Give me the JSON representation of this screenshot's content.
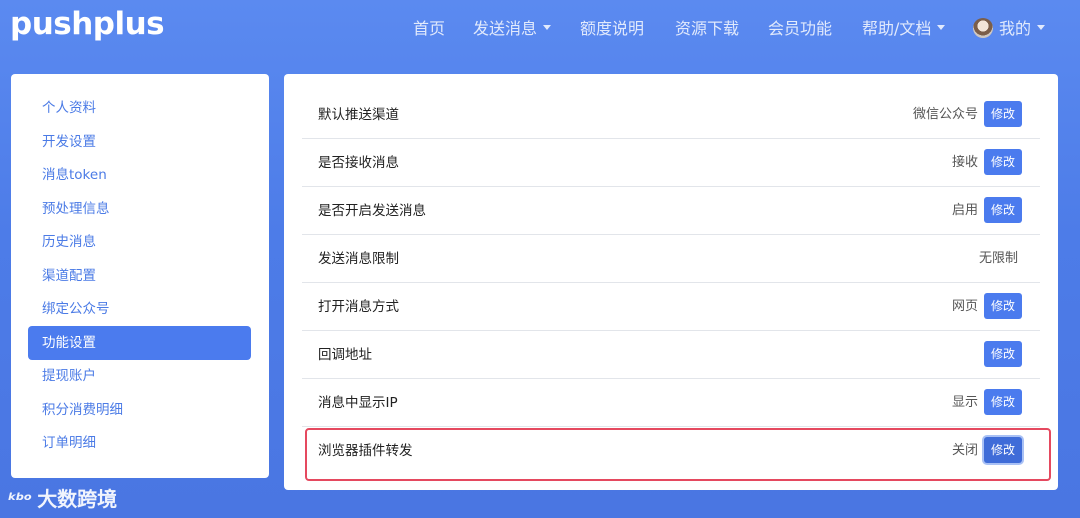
{
  "brand": {
    "logo": "pushplus"
  },
  "nav": {
    "items": [
      {
        "label": "首页",
        "dropdown": false
      },
      {
        "label": "发送消息",
        "dropdown": true
      },
      {
        "label": "额度说明",
        "dropdown": false
      },
      {
        "label": "资源下载",
        "dropdown": false
      },
      {
        "label": "会员功能",
        "dropdown": false
      },
      {
        "label": "帮助/文档",
        "dropdown": true
      }
    ],
    "user_label": "我的"
  },
  "sidebar": {
    "items": [
      {
        "label": "个人资料"
      },
      {
        "label": "开发设置"
      },
      {
        "label": "消息token"
      },
      {
        "label": "预处理信息"
      },
      {
        "label": "历史消息"
      },
      {
        "label": "渠道配置"
      },
      {
        "label": "绑定公众号"
      },
      {
        "label": "功能设置",
        "active": true
      },
      {
        "label": "提现账户"
      },
      {
        "label": "积分消费明细"
      },
      {
        "label": "订单明细"
      }
    ]
  },
  "settings": {
    "edit_label": "修改",
    "rows": [
      {
        "label": "默认推送渠道",
        "value": "微信公众号"
      },
      {
        "label": "是否接收消息",
        "value": "接收"
      },
      {
        "label": "是否开启发送消息",
        "value": "启用"
      },
      {
        "label": "发送消息限制",
        "value": "无限制"
      },
      {
        "label": "打开消息方式",
        "value": "网页"
      },
      {
        "label": "回调地址",
        "value": ""
      },
      {
        "label": "消息中显示IP",
        "value": "显示"
      },
      {
        "label": "浏览器插件转发",
        "value": "关闭"
      }
    ]
  },
  "watermark": {
    "logo_text": "ᵏᵇᵒ",
    "text": "大数跨境"
  },
  "colors": {
    "background": "#4d7ce8",
    "accent": "#4b7bee",
    "highlight_border": "#e5495f"
  }
}
